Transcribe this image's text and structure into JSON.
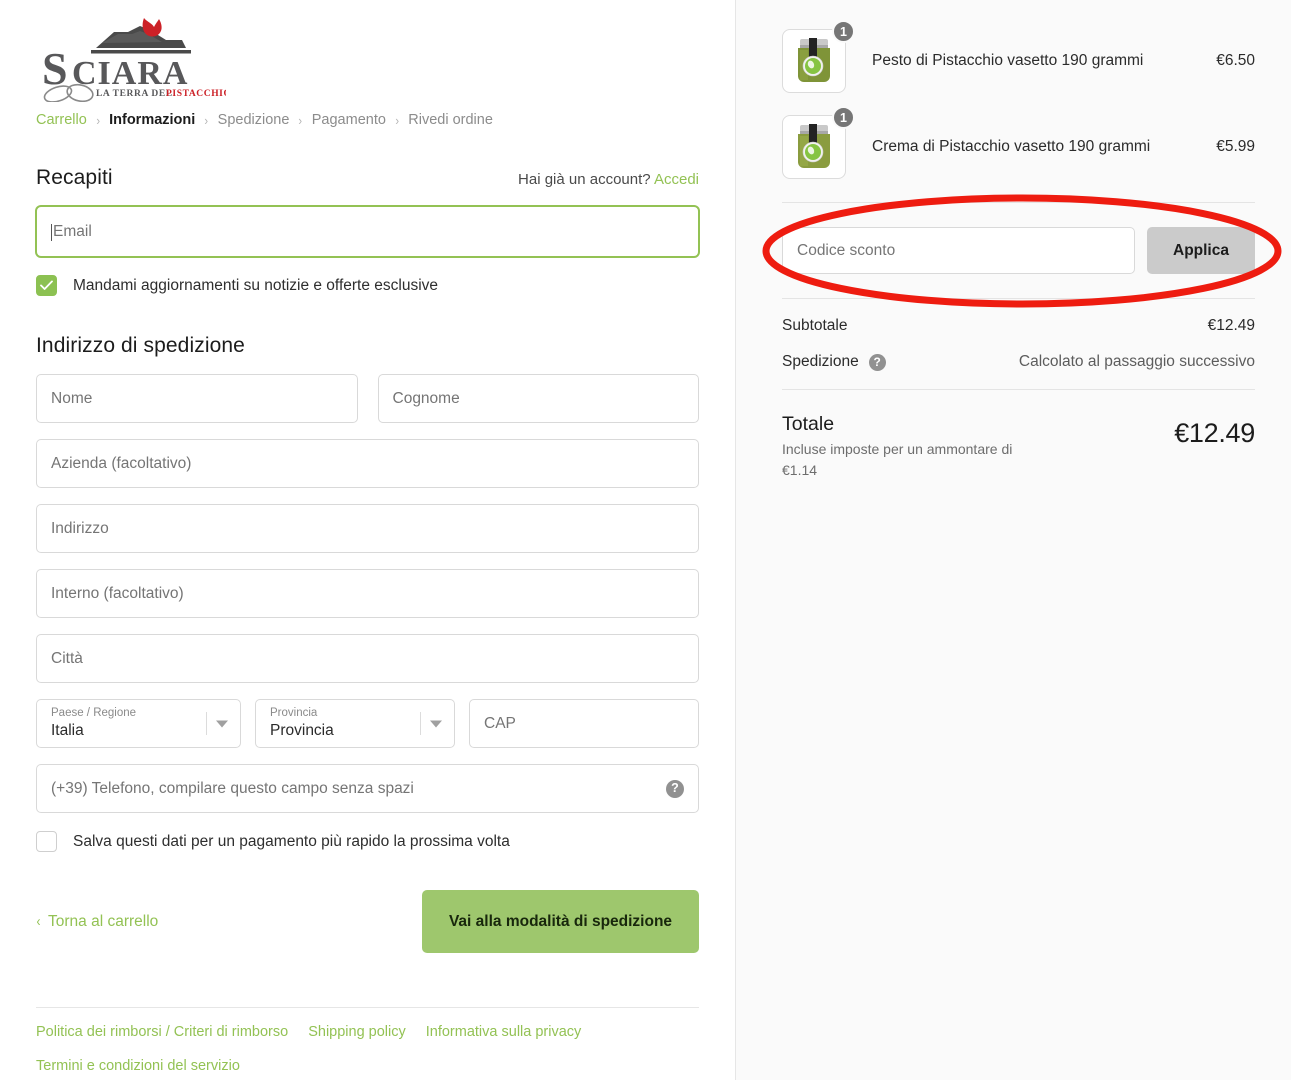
{
  "brand": {
    "name": "SCIARA",
    "tagline": "LA TERRA DEL PISTACCHIO",
    "tagline_accent": "PISTACCHIO",
    "logo_alt": "sciara-logo"
  },
  "breadcrumb": [
    {
      "label": "Carrello",
      "state": "done"
    },
    {
      "label": "Informazioni",
      "state": "current"
    },
    {
      "label": "Spedizione",
      "state": "upcoming"
    },
    {
      "label": "Pagamento",
      "state": "upcoming"
    },
    {
      "label": "Rivedi ordine",
      "state": "upcoming"
    }
  ],
  "breadcrumb_separator": "›",
  "contact": {
    "title": "Recapiti",
    "account_prompt": "Hai già un account?",
    "login_link": "Accedi",
    "email_placeholder": "Email",
    "email_value": "",
    "newsletter_label": "Mandami aggiornamenti su notizie e offerte esclusive",
    "newsletter_checked": true
  },
  "shipping": {
    "title": "Indirizzo di spedizione",
    "first_name_placeholder": "Nome",
    "last_name_placeholder": "Cognome",
    "company_placeholder": "Azienda (facoltativo)",
    "address_placeholder": "Indirizzo",
    "address2_placeholder": "Interno (facoltativo)",
    "city_placeholder": "Città",
    "country_label": "Paese / Regione",
    "country_value": "Italia",
    "province_label": "Provincia",
    "province_value": "Provincia",
    "postal_placeholder": "CAP",
    "phone_placeholder": "(+39) Telefono, compilare questo campo senza spazi",
    "phone_help_icon": "question-mark-icon",
    "save_info_label": "Salva questi dati per un pagamento più rapido la prossima volta",
    "save_info_checked": false
  },
  "actions": {
    "back_to_cart": "Torna al carrello",
    "back_chevron": "‹",
    "continue_button": "Vai alla modalità di spedizione"
  },
  "footer": {
    "links": [
      "Politica dei rimborsi / Criteri di rimborso",
      "Shipping policy",
      "Informativa sulla privacy",
      "Termini e condizioni del servizio"
    ]
  },
  "summary": {
    "items": [
      {
        "name": "Pesto di Pistacchio vasetto 190 grammi",
        "price": "€6.50",
        "quantity": "1",
        "image_alt": "pesto-di-pistacchio-jar"
      },
      {
        "name": "Crema di Pistacchio vasetto 190 grammi",
        "price": "€5.99",
        "quantity": "1",
        "image_alt": "crema-di-pistacchio-jar"
      }
    ],
    "discount_placeholder": "Codice sconto",
    "discount_value": "",
    "apply_button": "Applica",
    "subtotal_label": "Subtotale",
    "subtotal_value": "€12.49",
    "shipping_label": "Spedizione",
    "shipping_help_icon": "question-mark-icon",
    "shipping_value": "Calcolato al passaggio successivo",
    "total_label": "Totale",
    "total_note": "Incluse imposte per un ammontare di €1.14",
    "total_value": "€12.49"
  },
  "annotation": {
    "shape": "ellipse",
    "color": "#ee1c10",
    "target": "discount-code-area"
  },
  "colors": {
    "accent_green": "#93c254",
    "button_green": "#9ec76d",
    "checkbox_green": "#8cc152",
    "annotation_red": "#ee1c10",
    "panel_bg": "#fafafa",
    "apply_gray": "#cbcbcb"
  }
}
